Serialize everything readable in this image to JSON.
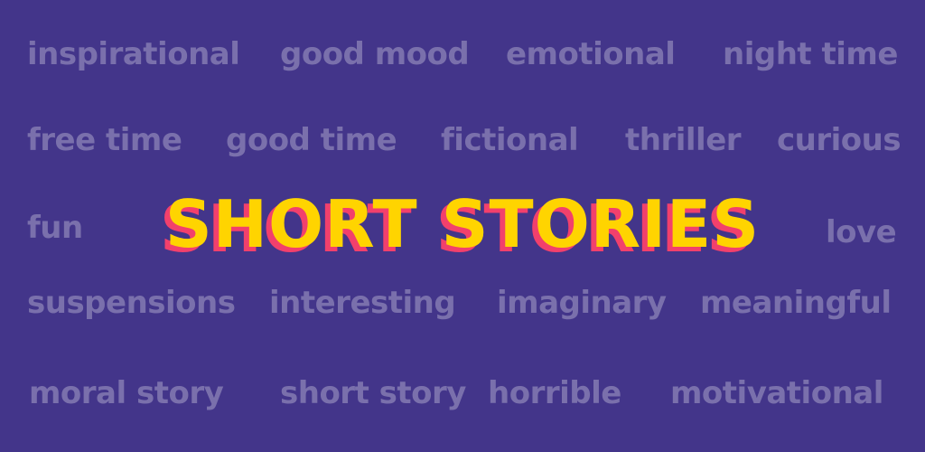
{
  "colors": {
    "background": "#43358a",
    "word": "#7a70ac",
    "title_fill": "#ffd400",
    "title_shadow": "#f2406c"
  },
  "title": "SHORT STORIES",
  "words": {
    "row1": [
      "inspirational",
      "good mood",
      "emotional",
      "night time"
    ],
    "row2": [
      "free time",
      "good time",
      "fictional",
      "thriller",
      "curious"
    ],
    "row3": [
      "fun",
      "love"
    ],
    "row4": [
      "suspensions",
      "interesting",
      "imaginary",
      "meaningful"
    ],
    "row5": [
      "moral story",
      "short story",
      "horrible",
      "motivational"
    ]
  }
}
